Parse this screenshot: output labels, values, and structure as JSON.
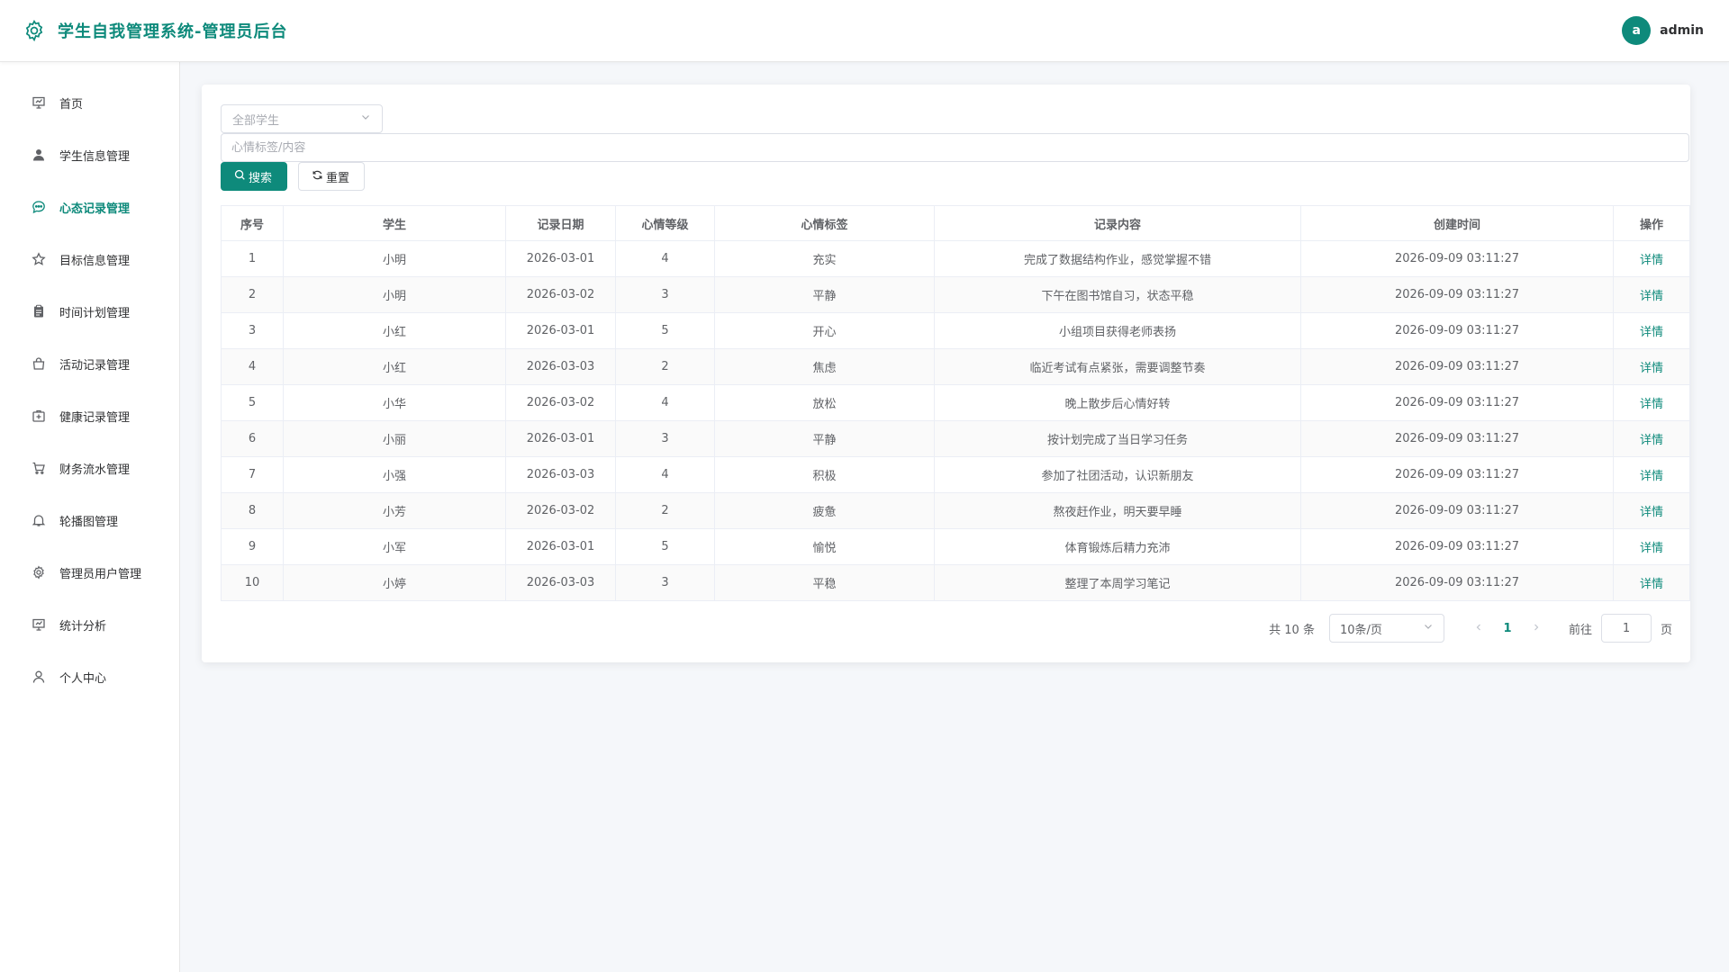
{
  "header": {
    "title": "学生自我管理系统-管理员后台",
    "avatar_letter": "a",
    "username": "admin"
  },
  "sidebar": {
    "items": [
      {
        "label": "首页",
        "icon": "presentation-icon"
      },
      {
        "label": "学生信息管理",
        "icon": "user-filled-icon"
      },
      {
        "label": "心态记录管理",
        "icon": "chat-dot-icon"
      },
      {
        "label": "目标信息管理",
        "icon": "star-icon"
      },
      {
        "label": "时间计划管理",
        "icon": "clipboard-icon"
      },
      {
        "label": "活动记录管理",
        "icon": "bag-icon"
      },
      {
        "label": "健康记录管理",
        "icon": "first-aid-icon"
      },
      {
        "label": "财务流水管理",
        "icon": "cart-icon"
      },
      {
        "label": "轮播图管理",
        "icon": "bell-icon"
      },
      {
        "label": "管理员用户管理",
        "icon": "gear-icon"
      },
      {
        "label": "统计分析",
        "icon": "presentation-icon"
      },
      {
        "label": "个人中心",
        "icon": "user-icon"
      }
    ],
    "active_index": 2
  },
  "filters": {
    "student_select_placeholder": "全部学生",
    "keyword_placeholder": "心情标签/内容",
    "keyword_value": "",
    "search_label": "搜索",
    "reset_label": "重置"
  },
  "table": {
    "columns": [
      "序号",
      "学生",
      "记录日期",
      "心情等级",
      "心情标签",
      "记录内容",
      "创建时间",
      "操作"
    ],
    "action_label": "详情",
    "rows": [
      {
        "no": "1",
        "student": "小明",
        "date": "2026-03-01",
        "level": "4",
        "tag": "充实",
        "content": "完成了数据结构作业，感觉掌握不错",
        "created": "2026-09-09 03:11:27"
      },
      {
        "no": "2",
        "student": "小明",
        "date": "2026-03-02",
        "level": "3",
        "tag": "平静",
        "content": "下午在图书馆自习，状态平稳",
        "created": "2026-09-09 03:11:27"
      },
      {
        "no": "3",
        "student": "小红",
        "date": "2026-03-01",
        "level": "5",
        "tag": "开心",
        "content": "小组项目获得老师表扬",
        "created": "2026-09-09 03:11:27"
      },
      {
        "no": "4",
        "student": "小红",
        "date": "2026-03-03",
        "level": "2",
        "tag": "焦虑",
        "content": "临近考试有点紧张，需要调整节奏",
        "created": "2026-09-09 03:11:27"
      },
      {
        "no": "5",
        "student": "小华",
        "date": "2026-03-02",
        "level": "4",
        "tag": "放松",
        "content": "晚上散步后心情好转",
        "created": "2026-09-09 03:11:27"
      },
      {
        "no": "6",
        "student": "小丽",
        "date": "2026-03-01",
        "level": "3",
        "tag": "平静",
        "content": "按计划完成了当日学习任务",
        "created": "2026-09-09 03:11:27"
      },
      {
        "no": "7",
        "student": "小强",
        "date": "2026-03-03",
        "level": "4",
        "tag": "积极",
        "content": "参加了社团活动，认识新朋友",
        "created": "2026-09-09 03:11:27"
      },
      {
        "no": "8",
        "student": "小芳",
        "date": "2026-03-02",
        "level": "2",
        "tag": "疲惫",
        "content": "熬夜赶作业，明天要早睡",
        "created": "2026-09-09 03:11:27"
      },
      {
        "no": "9",
        "student": "小军",
        "date": "2026-03-01",
        "level": "5",
        "tag": "愉悦",
        "content": "体育锻炼后精力充沛",
        "created": "2026-09-09 03:11:27"
      },
      {
        "no": "10",
        "student": "小婷",
        "date": "2026-03-03",
        "level": "3",
        "tag": "平稳",
        "content": "整理了本周学习笔记",
        "created": "2026-09-09 03:11:27"
      }
    ]
  },
  "pagination": {
    "total_text": "共 10 条",
    "page_size": "10条/页",
    "current_page": "1",
    "goto_label": "前往",
    "goto_value": "1",
    "page_suffix": "页"
  },
  "colors": {
    "accent": "#0e8a7b"
  }
}
